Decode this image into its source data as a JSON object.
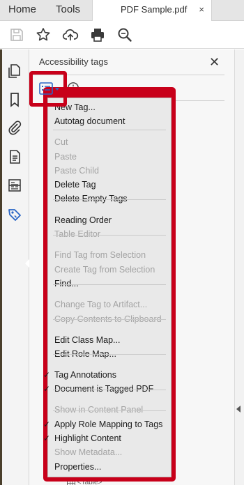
{
  "tabs": {
    "home": "Home",
    "tools": "Tools",
    "document": "PDF Sample.pdf",
    "close": "×"
  },
  "panel": {
    "title": "Accessibility tags",
    "close": "✕",
    "tree_item": "<Table>"
  },
  "icons": {
    "toolbar": [
      "save-icon",
      "bookmark-star-icon",
      "upload-cloud-icon",
      "print-icon",
      "zoom-search-icon"
    ],
    "rail": [
      "pages-icon",
      "bookmark-icon",
      "attachment-icon",
      "document-icon",
      "compare-icon",
      "accessibility-tag-icon"
    ]
  },
  "colors": {
    "highlight": "#c8001a",
    "accent": "#2a66c5",
    "menu_bg": "#e9e9e9",
    "disabled": "#a4a4a4"
  },
  "menu": {
    "items": [
      {
        "label": "New Tag...",
        "enabled": true,
        "checked": false
      },
      {
        "label": "Autotag document",
        "enabled": true,
        "checked": false
      },
      {
        "label": "Cut",
        "enabled": false,
        "checked": false
      },
      {
        "label": "Paste",
        "enabled": false,
        "checked": false
      },
      {
        "label": "Paste Child",
        "enabled": false,
        "checked": false
      },
      {
        "label": "Delete Tag",
        "enabled": true,
        "checked": false
      },
      {
        "label": "Delete Empty Tags",
        "enabled": true,
        "checked": false
      },
      {
        "label": "Reading Order",
        "enabled": true,
        "checked": false
      },
      {
        "label": "Table Editor",
        "enabled": false,
        "checked": false
      },
      {
        "label": "Find Tag from Selection",
        "enabled": false,
        "checked": false
      },
      {
        "label": "Create Tag from Selection",
        "enabled": false,
        "checked": false
      },
      {
        "label": "Find...",
        "enabled": true,
        "checked": false
      },
      {
        "label": "Change Tag to Artifact...",
        "enabled": false,
        "checked": false
      },
      {
        "label": "Copy Contents to Clipboard",
        "enabled": false,
        "checked": false
      },
      {
        "label": "Edit Class Map...",
        "enabled": true,
        "checked": false
      },
      {
        "label": "Edit Role Map...",
        "enabled": true,
        "checked": false
      },
      {
        "label": "Tag Annotations",
        "enabled": true,
        "checked": true
      },
      {
        "label": "Document is Tagged PDF",
        "enabled": true,
        "checked": true
      },
      {
        "label": "Show in Content Panel",
        "enabled": false,
        "checked": false
      },
      {
        "label": "Apply Role Mapping to Tags",
        "enabled": true,
        "checked": true
      },
      {
        "label": "Highlight Content",
        "enabled": true,
        "checked": true
      },
      {
        "label": "Show Metadata...",
        "enabled": false,
        "checked": false
      },
      {
        "label": "Properties...",
        "enabled": true,
        "checked": false
      }
    ]
  }
}
